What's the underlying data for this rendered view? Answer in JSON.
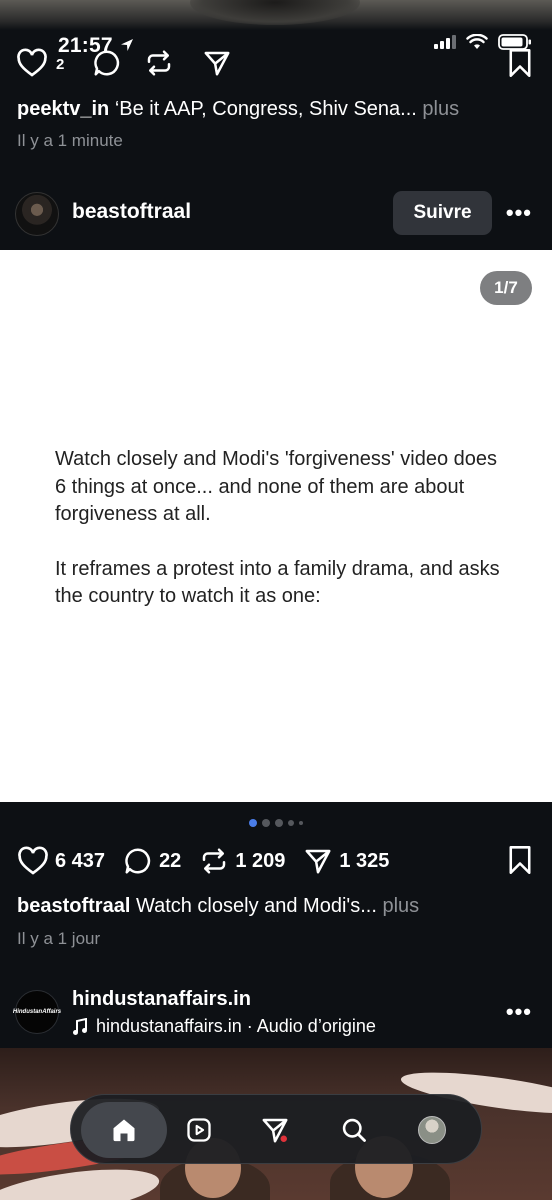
{
  "status_bar": {
    "time": "21:57"
  },
  "prev_post": {
    "like_count": "2",
    "username": "peektv_in",
    "caption": "‘Be it AAP, Congress, Shiv Sena...",
    "more": "plus",
    "time_ago": "Il y a 1 minute"
  },
  "post": {
    "username": "beastoftraal",
    "follow_label": "Suivre",
    "page_indicator": "1/7",
    "card_paragraph_1": "Watch closely and Modi's 'forgiveness' video does 6 things at once... and none of them are about forgiveness at all.",
    "card_paragraph_2": "It reframes a protest into a family drama, and asks the country to watch it as one:",
    "likes": "6 437",
    "comments": "22",
    "reposts": "1 209",
    "shares": "1 325",
    "caption_user": "beastoftraal",
    "caption_text": "Watch closely and Modi's...",
    "more": "plus",
    "time_ago": "Il y a 1 jour"
  },
  "next_post": {
    "username": "hindustanaffairs.in",
    "avatar_text": "HindustanAffairs",
    "audio": "hindustanaffairs.in · Audio d’origine"
  },
  "colors": {
    "background": "#0d1014",
    "accent_dot": "#4a7de8",
    "muted_text": "#8e9196",
    "follow_button": "#31343a"
  },
  "icons": [
    "heart-icon",
    "comment-icon",
    "repost-icon",
    "share-icon",
    "bookmark-icon",
    "more-icon",
    "music-icon",
    "home-icon",
    "reels-icon",
    "send-icon",
    "search-icon"
  ]
}
